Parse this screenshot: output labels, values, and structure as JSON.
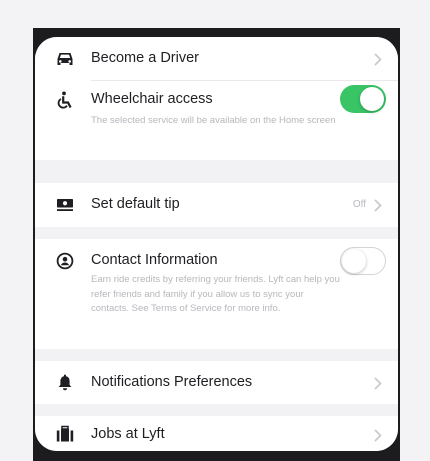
{
  "settings": {
    "become_driver": {
      "label": "Become a Driver",
      "icon": "car-icon"
    },
    "wheelchair": {
      "label": "Wheelchair access",
      "description": "The selected service will be available on the Home screen",
      "enabled": true,
      "icon": "wheelchair-icon"
    },
    "default_tip": {
      "label": "Set default tip",
      "value": "Off",
      "icon": "cash-icon"
    },
    "contact_info": {
      "label": "Contact Information",
      "description": "Earn ride credits by referring your friends. Lyft can help you refer friends and family if you allow us to sync your contacts. See Terms of Service for more info.",
      "enabled": false,
      "icon": "contact-icon"
    },
    "notifications": {
      "label": "Notifications Preferences",
      "icon": "bell-icon"
    },
    "jobs": {
      "label": "Jobs at Lyft",
      "icon": "briefcase-icon"
    }
  },
  "colors": {
    "toggle_on": "#39c466",
    "background": "#f3f3f5",
    "frame": "#1c1c1e"
  }
}
